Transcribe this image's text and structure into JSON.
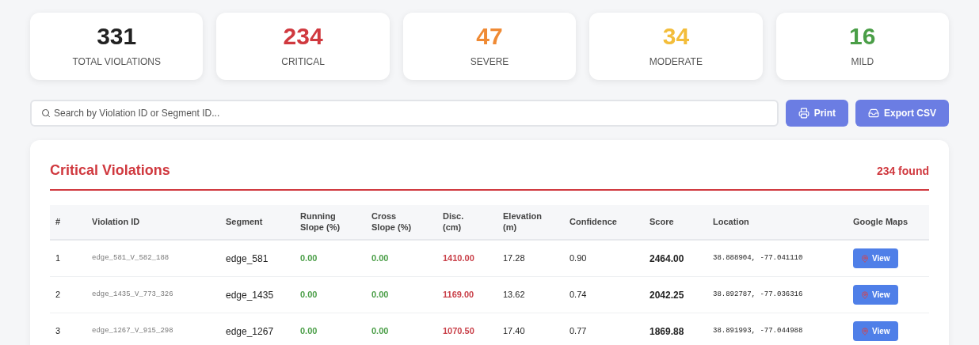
{
  "stats": [
    {
      "value": "331",
      "label": "TOTAL VIOLATIONS",
      "color": "#222222"
    },
    {
      "value": "234",
      "label": "CRITICAL",
      "color": "#d0393f"
    },
    {
      "value": "47",
      "label": "SEVERE",
      "color": "#ef8a34"
    },
    {
      "value": "34",
      "label": "MODERATE",
      "color": "#f3bd3a"
    },
    {
      "value": "16",
      "label": "MILD",
      "color": "#4a9e47"
    }
  ],
  "search": {
    "placeholder": "Search by Violation ID or Segment ID..."
  },
  "buttons": [
    {
      "label": "Print",
      "kind": "print"
    },
    {
      "label": "Export CSV",
      "kind": "export"
    }
  ],
  "panel": {
    "title": "Critical Violations",
    "count": "234 found"
  },
  "table": {
    "columns": [
      "#",
      "Violation ID",
      "Segment",
      "Running Slope (%)",
      "Cross Slope (%)",
      "Disc. (cm)",
      "Elevation (m)",
      "Confidence",
      "Score",
      "Location",
      "Google Maps"
    ],
    "rows": [
      {
        "index": "1",
        "violation_id": "edge_581_V_582_188",
        "segment": "edge_581",
        "running_slope": "0.00",
        "cross_slope": "0.00",
        "disc": "1410.00",
        "elevation": "17.28",
        "confidence": "0.90",
        "score": "2464.00",
        "location": "38.888904, -77.041110",
        "action": "View"
      },
      {
        "index": "2",
        "violation_id": "edge_1435_V_773_326",
        "segment": "edge_1435",
        "running_slope": "0.00",
        "cross_slope": "0.00",
        "disc": "1169.00",
        "elevation": "13.62",
        "confidence": "0.74",
        "score": "2042.25",
        "location": "38.892787, -77.036316",
        "action": "View"
      },
      {
        "index": "3",
        "violation_id": "edge_1267_V_915_298",
        "segment": "edge_1267",
        "running_slope": "0.00",
        "cross_slope": "0.00",
        "disc": "1070.50",
        "elevation": "17.40",
        "confidence": "0.77",
        "score": "1869.88",
        "location": "38.891993, -77.044988",
        "action": "View"
      }
    ]
  }
}
